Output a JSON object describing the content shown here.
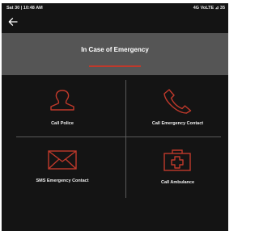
{
  "status": {
    "left": "Sat 30 | 10:48 AM",
    "right": "4G VoLTE ⊿ 35"
  },
  "appbar": {
    "back_icon": "arrow-left-icon"
  },
  "header": {
    "title": "In Case of Emergency"
  },
  "actions": [
    {
      "label": "Call Police",
      "icon": "police-person-icon"
    },
    {
      "label": "Call Emergency Contact",
      "icon": "phone-icon"
    },
    {
      "label": "SMS Emergency Contact",
      "icon": "envelope-icon"
    },
    {
      "label": "Call Ambulance",
      "icon": "medical-kit-icon"
    }
  ],
  "colors": {
    "accent": "#c0392b",
    "header_bg": "#555555",
    "background": "#141414"
  }
}
